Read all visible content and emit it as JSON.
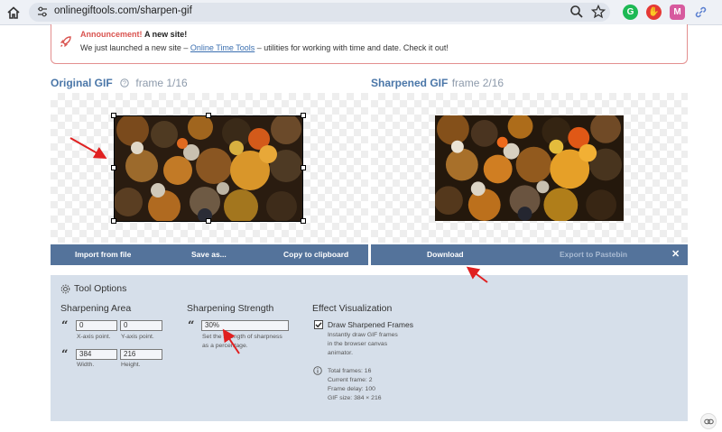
{
  "browser": {
    "url": "onlinegiftools.com/sharpen-gif",
    "ext_g_label": "G",
    "ext_mail_label": "M"
  },
  "announcement": {
    "title": "Announcement!",
    "subtitle": "A new site!",
    "text_before": "We just launched a new site – ",
    "link_text": "Online Time Tools",
    "text_after": " – utilities for working with time and date. Check it out!"
  },
  "original": {
    "title": "Original GIF",
    "frame": "frame 1/16",
    "buttons": {
      "import": "Import from file",
      "save": "Save as...",
      "copy": "Copy to clipboard"
    }
  },
  "sharpened": {
    "title": "Sharpened GIF",
    "frame": "frame 2/16",
    "buttons": {
      "download": "Download",
      "export": "Export to Pastebin",
      "close": "✕"
    }
  },
  "tool_options": {
    "title": "Tool Options",
    "sharpening_area": {
      "title": "Sharpening Area",
      "x_value": "0",
      "x_label": "X-axis point.",
      "y_value": "0",
      "y_label": "Y-axis point.",
      "width_value": "384",
      "width_label": "Width.",
      "height_value": "216",
      "height_label": "Height."
    },
    "sharpening_strength": {
      "title": "Sharpening Strength",
      "value": "30%",
      "desc1": "Set the strength of sharpness",
      "desc2": "as a percentage."
    },
    "effect_visualization": {
      "title": "Effect Visualization",
      "checkbox_label": "Draw Sharpened Frames",
      "checked": true,
      "desc1": "Instantly draw GIF frames",
      "desc2": "in the browser canvas",
      "desc3": "animator.",
      "total_frames": "Total frames: 16",
      "current_frame": "Current frame: 2",
      "frame_delay": "Frame delay: 100",
      "gif_size": "GIF size: 384 × 216"
    }
  },
  "colors": {
    "accent": "#4a76a8",
    "button_bar": "#54739b",
    "tool_panel": "#d6dfea",
    "announcement_red": "#d9534f",
    "annotation_arrow": "#e02020"
  }
}
